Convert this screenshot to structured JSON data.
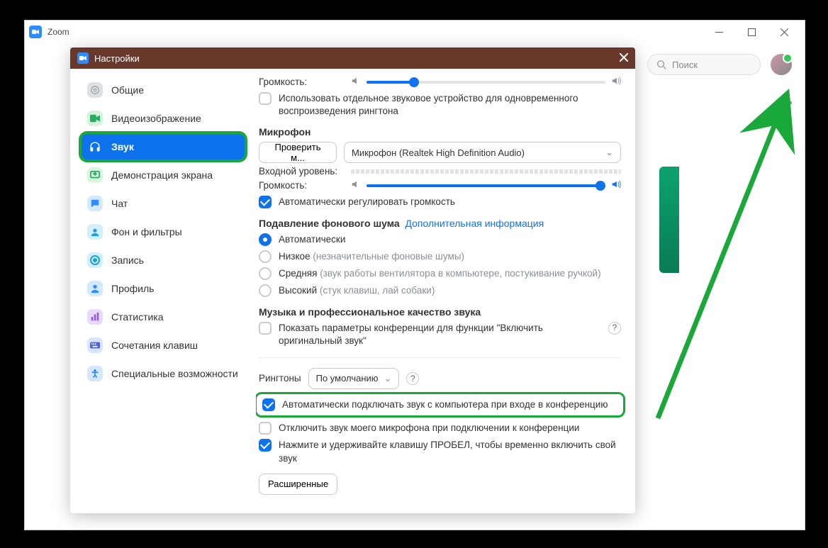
{
  "window": {
    "title": "Zoom"
  },
  "search": {
    "placeholder": "Поиск"
  },
  "dialog": {
    "title": "Настройки"
  },
  "sidebar": {
    "items": [
      {
        "label": "Общие"
      },
      {
        "label": "Видеоизображение"
      },
      {
        "label": "Звук"
      },
      {
        "label": "Демонстрация экрана"
      },
      {
        "label": "Чат"
      },
      {
        "label": "Фон и фильтры"
      },
      {
        "label": "Запись"
      },
      {
        "label": "Профиль"
      },
      {
        "label": "Статистика"
      },
      {
        "label": "Сочетания клавиш"
      },
      {
        "label": "Специальные возможности"
      }
    ]
  },
  "audio": {
    "volume_label": "Громкость:",
    "speaker_volume_pct": 20,
    "separate_ring_device": "Использовать отдельное звуковое устройство для одновременного воспроизведения рингтона",
    "mic_heading": "Микрофон",
    "test_mic_btn": "Проверить м...",
    "mic_device": "Микрофон (Realtek High Definition Audio)",
    "input_level_label": "Входной уровень:",
    "mic_volume_label": "Громкость:",
    "mic_volume_pct": 98,
    "auto_adjust": "Автоматически регулировать громкость",
    "noise_heading": "Подавление фонового шума",
    "noise_info": "Дополнительная информация",
    "noise_options": [
      {
        "label": "Автоматически",
        "hint": ""
      },
      {
        "label": "Низкое",
        "hint": "(незначительные фоновые шумы)"
      },
      {
        "label": "Средняя",
        "hint": "(звук работы вентилятора в компьютере, постукивание ручкой)"
      },
      {
        "label": "Высокий",
        "hint": "(стук клавиш, лай собаки)"
      }
    ],
    "music_heading": "Музыка и профессиональное качество звука",
    "show_in_meeting": "Показать параметры конференции для функции \"Включить оригинальный звук\"",
    "ringtones_label": "Рингтоны",
    "ringtone_value": "По умолчанию",
    "auto_join_audio": "Автоматически подключать звук с компьютера при входе в конференцию",
    "mute_on_join": "Отключить звук моего микрофона при подключении к конференции",
    "push_to_talk": "Нажмите и удерживайте клавишу ПРОБЕЛ, чтобы временно включить свой звук",
    "advanced_btn": "Расширенные"
  }
}
